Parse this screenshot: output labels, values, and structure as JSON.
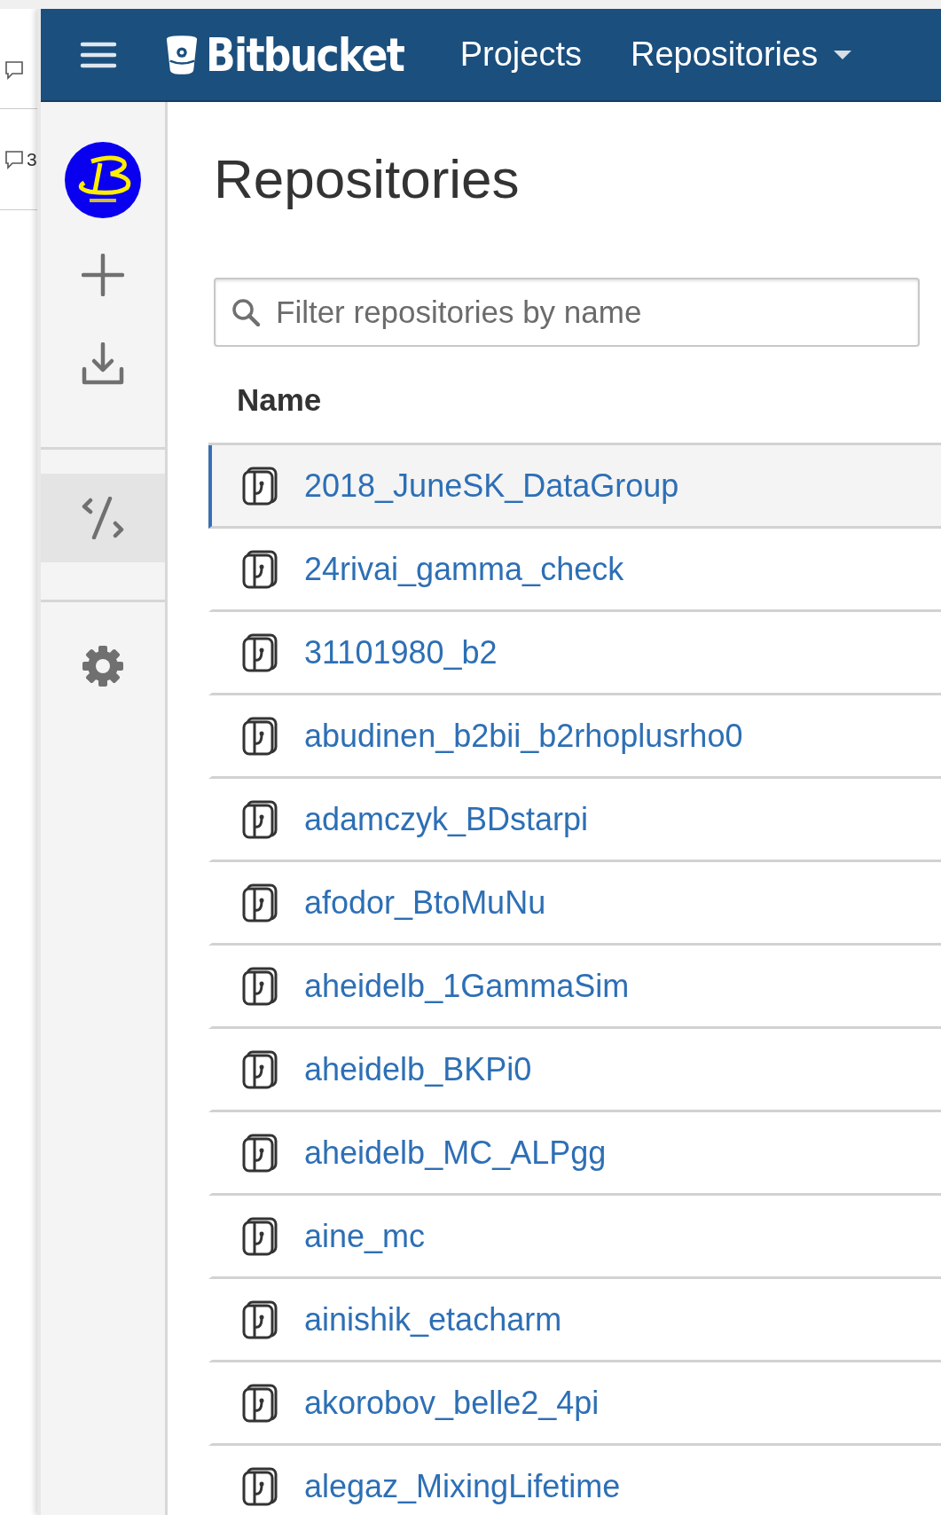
{
  "background_page": {
    "comments": [
      {
        "kind": "icon_only"
      },
      {
        "kind": "count",
        "count": "3"
      }
    ]
  },
  "header": {
    "brand": "Bitbucket",
    "nav": [
      {
        "label": "Projects",
        "dropdown": false
      },
      {
        "label": "Repositories",
        "dropdown": true
      }
    ]
  },
  "sidebar": {
    "groups": [
      [
        {
          "kind": "avatar",
          "selected": false
        },
        {
          "kind": "create",
          "selected": false
        },
        {
          "kind": "import",
          "selected": false
        }
      ],
      [
        {
          "kind": "code",
          "selected": true
        }
      ],
      [
        {
          "kind": "settings",
          "selected": false
        }
      ]
    ]
  },
  "main": {
    "title": "Repositories",
    "search": {
      "placeholder": "Filter repositories by name"
    },
    "column": "Name",
    "rows": [
      {
        "name": "2018_JuneSK_DataGroup",
        "selected": true
      },
      {
        "name": "24rivai_gamma_check",
        "selected": false
      },
      {
        "name": "31101980_b2",
        "selected": false
      },
      {
        "name": "abudinen_b2bii_b2rhoplusrho0",
        "selected": false
      },
      {
        "name": "adamczyk_BDstarpi",
        "selected": false
      },
      {
        "name": "afodor_BtoMuNu",
        "selected": false
      },
      {
        "name": "aheidelb_1GammaSim",
        "selected": false
      },
      {
        "name": "aheidelb_BKPi0",
        "selected": false
      },
      {
        "name": "aheidelb_MC_ALPgg",
        "selected": false
      },
      {
        "name": "aine_mc",
        "selected": false
      },
      {
        "name": "ainishik_etacharm",
        "selected": false
      },
      {
        "name": "akorobov_belle2_4pi",
        "selected": false
      },
      {
        "name": "alegaz_MixingLifetime",
        "selected": false
      }
    ]
  }
}
